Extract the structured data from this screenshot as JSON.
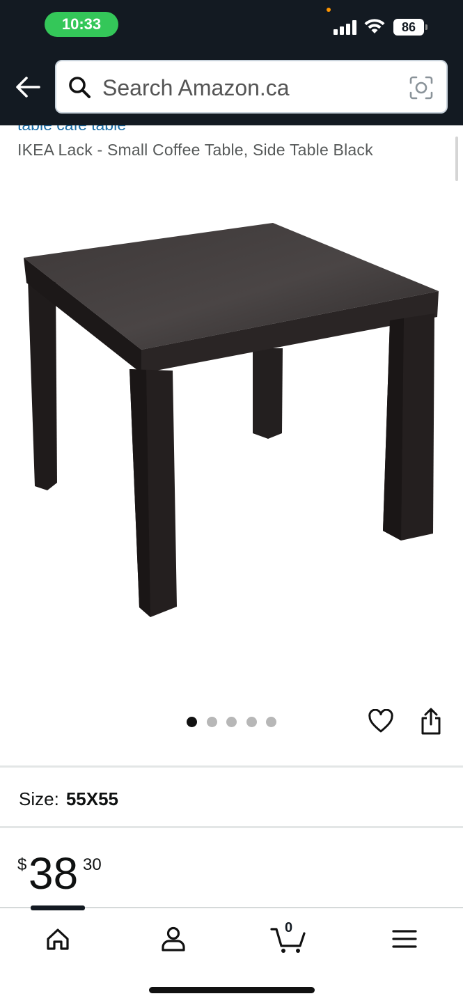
{
  "status_bar": {
    "time": "10:33",
    "battery": "86"
  },
  "search": {
    "placeholder": "Search Amazon.ca"
  },
  "product": {
    "cut_title": "table café table",
    "subtitle": "IKEA Lack - Small Coffee Table, Side Table Black",
    "image_alt": "Black square side table",
    "carousel": {
      "count": 5,
      "active_index": 0
    }
  },
  "size": {
    "label": "Size:",
    "value": "55X55"
  },
  "price": {
    "currency": "$",
    "whole": "38",
    "fraction": "30"
  },
  "bottom_nav": {
    "items": [
      {
        "icon": "home-icon"
      },
      {
        "icon": "account-icon"
      },
      {
        "icon": "cart-icon",
        "count": "0"
      },
      {
        "icon": "menu-icon"
      }
    ],
    "active_index": 0
  },
  "colors": {
    "header_bg": "#131a22",
    "link": "#1b6ea8",
    "time_pill": "#34c759"
  }
}
